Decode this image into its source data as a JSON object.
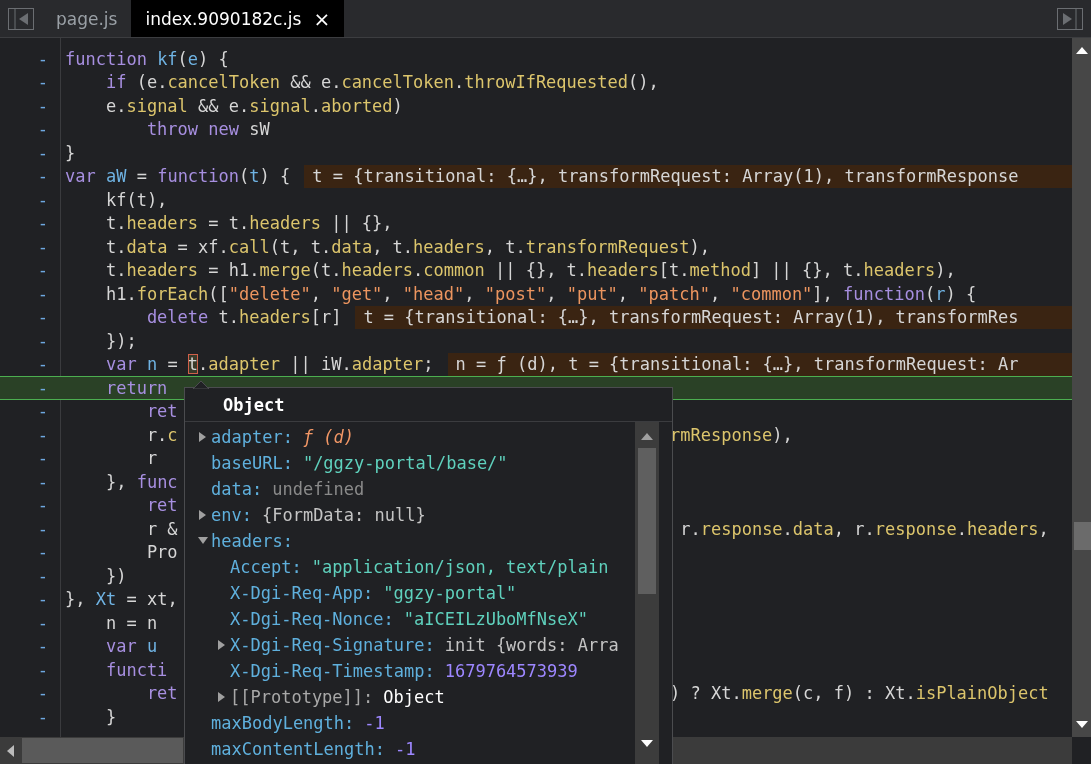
{
  "tabs": [
    {
      "label": "page.js",
      "selected": false
    },
    {
      "label": "index.9090182c.js",
      "selected": true,
      "close": "×"
    }
  ],
  "lines": [
    {
      "marker": "-",
      "current": false,
      "tokens": [
        {
          "kind": "keyword",
          "text": "function"
        },
        {
          "kind": "name",
          "text": " kf"
        },
        {
          "kind": "plain",
          "text": "("
        },
        {
          "kind": "name",
          "text": "e"
        },
        {
          "kind": "plain",
          "text": ") {"
        }
      ]
    },
    {
      "marker": "-",
      "current": false,
      "tokens": [
        {
          "kind": "keyword",
          "text": "    if"
        },
        {
          "kind": "plain",
          "text": " (e."
        },
        {
          "kind": "property",
          "text": "cancelToken"
        },
        {
          "kind": "plain",
          "text": " && e."
        },
        {
          "kind": "property",
          "text": "cancelToken"
        },
        {
          "kind": "plain",
          "text": "."
        },
        {
          "kind": "property",
          "text": "throwIfRequested"
        },
        {
          "kind": "plain",
          "text": "(),"
        }
      ]
    },
    {
      "marker": "-",
      "current": false,
      "tokens": [
        {
          "kind": "plain",
          "text": "    e."
        },
        {
          "kind": "property",
          "text": "signal"
        },
        {
          "kind": "plain",
          "text": " && e."
        },
        {
          "kind": "property",
          "text": "signal"
        },
        {
          "kind": "plain",
          "text": "."
        },
        {
          "kind": "property",
          "text": "aborted"
        },
        {
          "kind": "plain",
          "text": ")"
        }
      ]
    },
    {
      "marker": "-",
      "current": false,
      "tokens": [
        {
          "kind": "keyword",
          "text": "        throw"
        },
        {
          "kind": "keyword",
          "text": " new"
        },
        {
          "kind": "plain",
          "text": " sW"
        }
      ]
    },
    {
      "marker": "-",
      "current": false,
      "tokens": [
        {
          "kind": "plain",
          "text": "}"
        }
      ]
    },
    {
      "marker": "-",
      "current": false,
      "tokens": [
        {
          "kind": "keyword",
          "text": "var"
        },
        {
          "kind": "name",
          "text": " aW"
        },
        {
          "kind": "plain",
          "text": " = "
        },
        {
          "kind": "keyword",
          "text": "function"
        },
        {
          "kind": "plain",
          "text": "("
        },
        {
          "kind": "name",
          "text": "t"
        },
        {
          "kind": "plain",
          "text": ") {"
        }
      ],
      "inline_value": "t = {transitional: {…}, transformRequest: Array(1), transformResponse"
    },
    {
      "marker": "-",
      "current": false,
      "tokens": [
        {
          "kind": "plain",
          "text": "    kf(t),"
        }
      ]
    },
    {
      "marker": "-",
      "current": false,
      "tokens": [
        {
          "kind": "plain",
          "text": "    t."
        },
        {
          "kind": "property",
          "text": "headers"
        },
        {
          "kind": "plain",
          "text": " = t."
        },
        {
          "kind": "property",
          "text": "headers"
        },
        {
          "kind": "plain",
          "text": " || {},"
        }
      ]
    },
    {
      "marker": "-",
      "current": false,
      "tokens": [
        {
          "kind": "plain",
          "text": "    t."
        },
        {
          "kind": "property",
          "text": "data"
        },
        {
          "kind": "plain",
          "text": " = xf."
        },
        {
          "kind": "property",
          "text": "call"
        },
        {
          "kind": "plain",
          "text": "(t, t."
        },
        {
          "kind": "property",
          "text": "data"
        },
        {
          "kind": "plain",
          "text": ", t."
        },
        {
          "kind": "property",
          "text": "headers"
        },
        {
          "kind": "plain",
          "text": ", t."
        },
        {
          "kind": "property",
          "text": "transformRequest"
        },
        {
          "kind": "plain",
          "text": "),"
        }
      ]
    },
    {
      "marker": "-",
      "current": false,
      "tokens": [
        {
          "kind": "plain",
          "text": "    t."
        },
        {
          "kind": "property",
          "text": "headers"
        },
        {
          "kind": "plain",
          "text": " = h1."
        },
        {
          "kind": "property",
          "text": "merge"
        },
        {
          "kind": "plain",
          "text": "(t."
        },
        {
          "kind": "property",
          "text": "headers"
        },
        {
          "kind": "plain",
          "text": "."
        },
        {
          "kind": "property",
          "text": "common"
        },
        {
          "kind": "plain",
          "text": " || {}, t."
        },
        {
          "kind": "property",
          "text": "headers"
        },
        {
          "kind": "plain",
          "text": "[t."
        },
        {
          "kind": "property",
          "text": "method"
        },
        {
          "kind": "plain",
          "text": "] || {}, t."
        },
        {
          "kind": "property",
          "text": "headers"
        },
        {
          "kind": "plain",
          "text": "),"
        }
      ]
    },
    {
      "marker": "-",
      "current": false,
      "tokens": [
        {
          "kind": "plain",
          "text": "    h1."
        },
        {
          "kind": "property",
          "text": "forEach"
        },
        {
          "kind": "plain",
          "text": "(["
        },
        {
          "kind": "string",
          "text": "\"delete\""
        },
        {
          "kind": "plain",
          "text": ", "
        },
        {
          "kind": "string",
          "text": "\"get\""
        },
        {
          "kind": "plain",
          "text": ", "
        },
        {
          "kind": "string",
          "text": "\"head\""
        },
        {
          "kind": "plain",
          "text": ", "
        },
        {
          "kind": "string",
          "text": "\"post\""
        },
        {
          "kind": "plain",
          "text": ", "
        },
        {
          "kind": "string",
          "text": "\"put\""
        },
        {
          "kind": "plain",
          "text": ", "
        },
        {
          "kind": "string",
          "text": "\"patch\""
        },
        {
          "kind": "plain",
          "text": ", "
        },
        {
          "kind": "string",
          "text": "\"common\""
        },
        {
          "kind": "plain",
          "text": "], "
        },
        {
          "kind": "keyword",
          "text": "function"
        },
        {
          "kind": "plain",
          "text": "("
        },
        {
          "kind": "name",
          "text": "r"
        },
        {
          "kind": "plain",
          "text": ") {"
        }
      ]
    },
    {
      "marker": "-",
      "current": false,
      "tokens": [
        {
          "kind": "keyword",
          "text": "        delete"
        },
        {
          "kind": "plain",
          "text": " t."
        },
        {
          "kind": "property",
          "text": "headers"
        },
        {
          "kind": "plain",
          "text": "[r]"
        }
      ],
      "inline_value": "t = {transitional: {…}, transformRequest: Array(1), transformRes"
    },
    {
      "marker": "-",
      "current": false,
      "tokens": [
        {
          "kind": "plain",
          "text": "    });"
        }
      ]
    },
    {
      "marker": "-",
      "current": false,
      "tokens": [
        {
          "kind": "keyword",
          "text": "    var"
        },
        {
          "kind": "name",
          "text": " n"
        },
        {
          "kind": "plain",
          "text": " = "
        },
        {
          "kind": "hovered",
          "text": "t"
        },
        {
          "kind": "plain",
          "text": "."
        },
        {
          "kind": "property",
          "text": "adapter"
        },
        {
          "kind": "plain",
          "text": " || iW."
        },
        {
          "kind": "property",
          "text": "adapter"
        },
        {
          "kind": "plain",
          "text": ";"
        }
      ],
      "inline_value": "n = ƒ (d), t = {transitional: {…}, transformRequest: Ar"
    },
    {
      "marker": "-",
      "current": true,
      "tokens": [
        {
          "kind": "keyword",
          "text": "    return"
        }
      ]
    },
    {
      "marker": "-",
      "current": false,
      "tokens": [
        {
          "kind": "keyword",
          "text": "        ret"
        }
      ]
    },
    {
      "marker": "-",
      "current": false,
      "tokens": [
        {
          "kind": "plain",
          "text": "        r."
        },
        {
          "kind": "property",
          "text": "c"
        }
      ],
      "tail": [
        {
          "kind": "property",
          "text": "rmResponse"
        },
        {
          "kind": "plain",
          "text": "),"
        }
      ]
    },
    {
      "marker": "-",
      "current": false,
      "tokens": [
        {
          "kind": "plain",
          "text": "        r"
        }
      ]
    },
    {
      "marker": "-",
      "current": false,
      "tokens": [
        {
          "kind": "plain",
          "text": "    }, "
        },
        {
          "kind": "keyword",
          "text": "func"
        }
      ]
    },
    {
      "marker": "-",
      "current": false,
      "tokens": [
        {
          "kind": "keyword",
          "text": "        ret"
        }
      ]
    },
    {
      "marker": "-",
      "current": false,
      "tokens": [
        {
          "kind": "plain",
          "text": "        r &"
        }
      ],
      "tail": [
        {
          "kind": "plain",
          "text": " r."
        },
        {
          "kind": "property",
          "text": "response"
        },
        {
          "kind": "plain",
          "text": "."
        },
        {
          "kind": "property",
          "text": "data"
        },
        {
          "kind": "plain",
          "text": ", r."
        },
        {
          "kind": "property",
          "text": "response"
        },
        {
          "kind": "plain",
          "text": "."
        },
        {
          "kind": "property",
          "text": "headers"
        },
        {
          "kind": "plain",
          "text": ","
        }
      ]
    },
    {
      "marker": "-",
      "current": false,
      "tokens": [
        {
          "kind": "plain",
          "text": "        Pro"
        }
      ]
    },
    {
      "marker": "-",
      "current": false,
      "tokens": [
        {
          "kind": "plain",
          "text": "    })"
        }
      ]
    },
    {
      "marker": "-",
      "current": false,
      "tokens": [
        {
          "kind": "plain",
          "text": "}, "
        },
        {
          "kind": "name",
          "text": "Xt"
        },
        {
          "kind": "plain",
          "text": " = xt,"
        }
      ]
    },
    {
      "marker": "-",
      "current": false,
      "tokens": [
        {
          "kind": "plain",
          "text": "    n = n"
        }
      ]
    },
    {
      "marker": "-",
      "current": false,
      "tokens": [
        {
          "kind": "keyword",
          "text": "    var"
        },
        {
          "kind": "name",
          "text": " u"
        }
      ]
    },
    {
      "marker": "-",
      "current": false,
      "tokens": [
        {
          "kind": "keyword",
          "text": "    functi"
        }
      ]
    },
    {
      "marker": "-",
      "current": false,
      "tokens": [
        {
          "kind": "keyword",
          "text": "        ret"
        }
      ],
      "tail": [
        {
          "kind": "plain",
          "text": ") ? Xt."
        },
        {
          "kind": "property",
          "text": "merge"
        },
        {
          "kind": "plain",
          "text": "(c, f) : Xt."
        },
        {
          "kind": "property",
          "text": "isPlainObject"
        }
      ]
    },
    {
      "marker": "-",
      "current": false,
      "tokens": [
        {
          "kind": "plain",
          "text": "    }"
        }
      ]
    }
  ],
  "popover": {
    "title": "Object",
    "properties": [
      {
        "kind": "function",
        "key": "adapter:",
        "value": "ƒ (d)",
        "expanded": false
      },
      {
        "kind": "string",
        "key": "baseURL:",
        "value": "\"/ggzy-portal/base/\""
      },
      {
        "kind": "undefined",
        "key": "data:",
        "value": "undefined"
      },
      {
        "kind": "object",
        "key": "env:",
        "value": "{FormData: null}",
        "expanded": false
      },
      {
        "kind": "object",
        "key": "headers:",
        "expanded": true,
        "children": [
          {
            "kind": "string",
            "key": "Accept:",
            "value": "\"application/json, text/plain"
          },
          {
            "kind": "string",
            "key": "X-Dgi-Req-App:",
            "value": "\"ggzy-portal\""
          },
          {
            "kind": "string",
            "key": "X-Dgi-Req-Nonce:",
            "value": "\"aICEILzUboMfNseX\""
          },
          {
            "kind": "object",
            "key": "X-Dgi-Req-Signature:",
            "value": "init {words: Arra",
            "expanded": false
          },
          {
            "kind": "number",
            "key": "X-Dgi-Req-Timestamp:",
            "value": "1679764573939"
          },
          {
            "kind": "prototype",
            "key": "[[Prototype]]:",
            "value": "Object",
            "expanded": false
          }
        ]
      },
      {
        "kind": "number",
        "key": "maxBodyLength:",
        "value": "-1"
      },
      {
        "kind": "number",
        "key": "maxContentLength:",
        "value": "-1"
      }
    ]
  }
}
